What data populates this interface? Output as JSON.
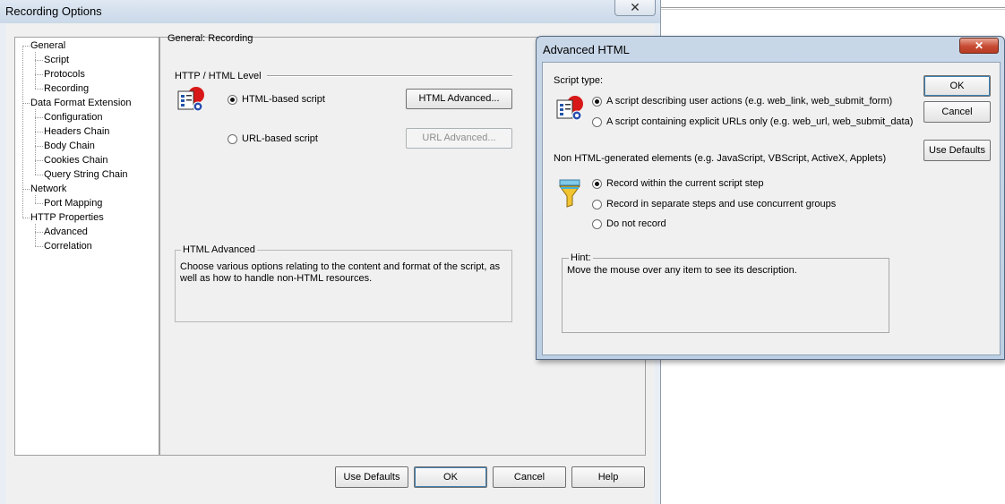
{
  "recording_options": {
    "title": "Recording Options",
    "close_glyph": "✕",
    "tree": [
      {
        "label": "General",
        "level": 0
      },
      {
        "label": "Script",
        "level": 1
      },
      {
        "label": "Protocols",
        "level": 1
      },
      {
        "label": "Recording",
        "level": 1
      },
      {
        "label": "Data Format Extension",
        "level": 0
      },
      {
        "label": "Configuration",
        "level": 1
      },
      {
        "label": "Headers Chain",
        "level": 1
      },
      {
        "label": "Body Chain",
        "level": 1
      },
      {
        "label": "Cookies Chain",
        "level": 1
      },
      {
        "label": "Query String Chain",
        "level": 1
      },
      {
        "label": "Network",
        "level": 0
      },
      {
        "label": "Port Mapping",
        "level": 1
      },
      {
        "label": "HTTP Properties",
        "level": 0
      },
      {
        "label": "Advanced",
        "level": 1
      },
      {
        "label": "Correlation",
        "level": 1
      }
    ],
    "pane_title": "General: Recording",
    "level_heading": "HTTP / HTML Level",
    "html_based_label": "HTML-based script",
    "url_based_label": "URL-based script",
    "html_advanced_button": "HTML Advanced...",
    "url_advanced_button": "URL Advanced...",
    "info_group_title": "HTML Advanced",
    "info_group_text": "Choose various options relating to the content and format of the script, as well as how to handle non-HTML resources.",
    "buttons": {
      "use_defaults": "Use Defaults",
      "ok": "OK",
      "cancel": "Cancel",
      "help": "Help"
    }
  },
  "advanced_html": {
    "title": "Advanced HTML",
    "close_glyph": "✕",
    "script_type_label": "Script type:",
    "script_type_options": [
      "A script describing user actions (e.g. web_link, web_submit_form)",
      "A script containing explicit URLs only (e.g. web_url, web_submit_data)"
    ],
    "non_html_label": "Non HTML-generated elements (e.g. JavaScript, VBScript, ActiveX, Applets)",
    "non_html_options": [
      "Record within the current script step",
      "Record in separate steps and use concurrent groups",
      "Do not record"
    ],
    "hint_title": "Hint:",
    "hint_text": "Move the mouse over any item to see its description.",
    "buttons": {
      "ok": "OK",
      "cancel": "Cancel",
      "use_defaults": "Use Defaults"
    }
  }
}
